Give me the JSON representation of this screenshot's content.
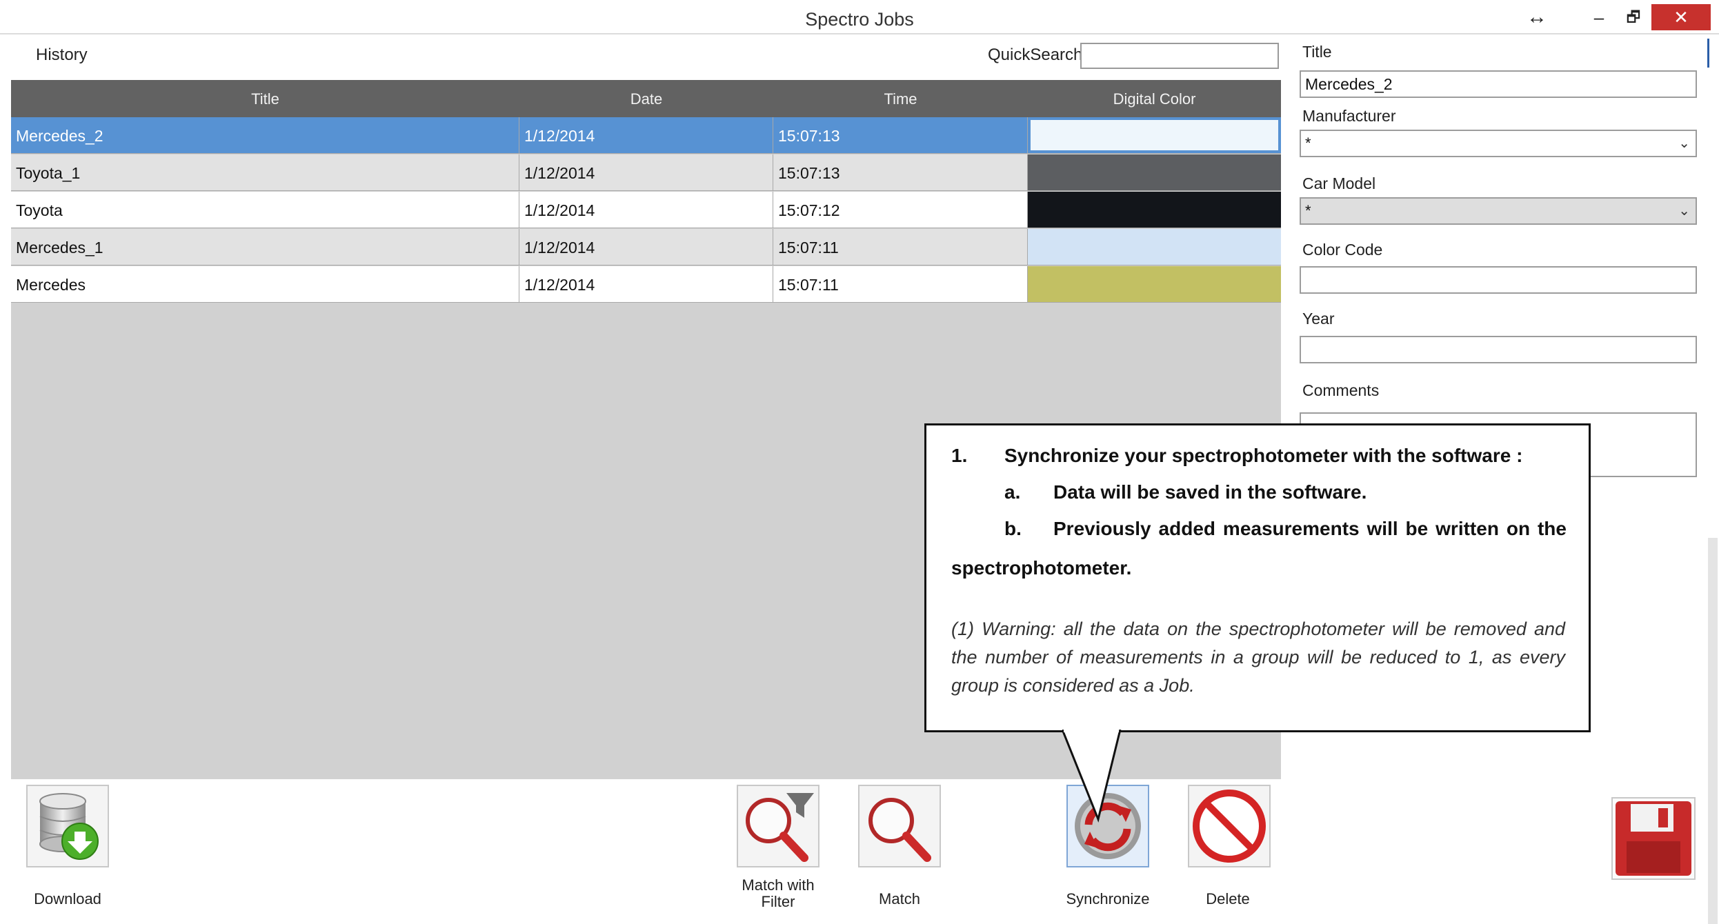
{
  "window": {
    "title": "Spectro Jobs",
    "controls": {
      "resize": "↔",
      "minimize": "–",
      "restore": "🗗",
      "close": "✕"
    }
  },
  "history": {
    "label": "History"
  },
  "quicksearch": {
    "label": "QuickSearch",
    "value": ""
  },
  "grid": {
    "columns": [
      "Title",
      "Date",
      "Time",
      "Digital Color"
    ],
    "rows": [
      {
        "title": "Mercedes_2",
        "date": "1/12/2014",
        "time": "15:07:13",
        "color": "#eef6fc",
        "selected": true
      },
      {
        "title": "Toyota_1",
        "date": "1/12/2014",
        "time": "15:07:13",
        "color": "#5c5e61"
      },
      {
        "title": "Toyota",
        "date": "1/12/2014",
        "time": "15:07:12",
        "color": "#12151a"
      },
      {
        "title": "Mercedes_1",
        "date": "1/12/2014",
        "time": "15:07:11",
        "color": "#d2e3f5"
      },
      {
        "title": "Mercedes",
        "date": "1/12/2014",
        "time": "15:07:11",
        "color": "#c2c063"
      }
    ]
  },
  "form": {
    "title_label": "Title",
    "title_value": "Mercedes_2",
    "manufacturer_label": "Manufacturer",
    "manufacturer_value": "*",
    "car_model_label": "Car Model",
    "car_model_value": "*",
    "color_code_label": "Color Code",
    "color_code_value": "",
    "year_label": "Year",
    "year_value": "",
    "comments_label": "Comments"
  },
  "toolbar": {
    "download": "Download",
    "match_filter_line1": "Match with",
    "match_filter_line2": "Filter",
    "match": "Match",
    "synchronize": "Synchronize",
    "delete": "Delete"
  },
  "icons": {
    "download": "database-download-icon",
    "match_filter": "magnifier-filter-icon",
    "match": "magnifier-icon",
    "synchronize": "sync-icon",
    "delete": "no-entry-icon",
    "save": "floppy-disk-icon"
  },
  "callout": {
    "item_num": "1.",
    "item_text": "Synchronize your spectrophotometer with the software :",
    "a_num": "a.",
    "a_text": "Data will be saved in the software.",
    "b_num": "b.",
    "b_text": "Previously added measurements will be written on the",
    "b_cont": "spectrophotometer.",
    "warning": "(1)     Warning: all the data on the spectrophotometer will be removed and the number of measurements in a group will be reduced to 1, as every group is considered as a Job."
  },
  "colors": {
    "header_bg": "#626262",
    "selected_row": "#5792d3",
    "grid_bg": "#d1d1d1",
    "close_button": "#c7312d"
  }
}
